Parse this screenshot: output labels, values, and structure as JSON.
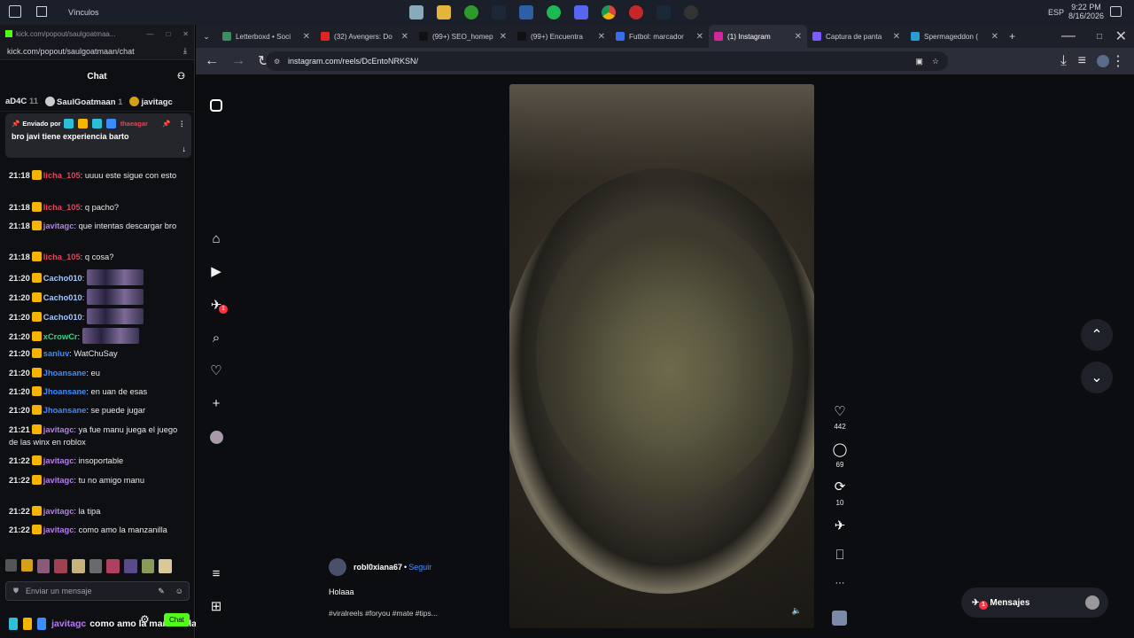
{
  "taskbar": {
    "label": "Vínculos",
    "lang": "ESP",
    "time": "9:22 PM",
    "date": "8/16/2026"
  },
  "kick": {
    "window_title": "kick.com/popout/saulgoatmaa...",
    "url": "kick.com/popout/saulgoatmaan/chat",
    "chat_title": "Chat",
    "leaderboard": [
      {
        "name": "aD4C",
        "count": "11"
      },
      {
        "name": "SaulGoatmaan",
        "count": "1"
      },
      {
        "name": "javitagc",
        "count": ""
      }
    ],
    "pinned": {
      "label": "Enviado por",
      "user": "thaeagar",
      "text": "bro javi tiene experiencia barto"
    },
    "messages": [
      {
        "time": "21:18",
        "user": "licha_105",
        "text": "uuuu este sigue con esto",
        "color": "#e0455a"
      },
      {
        "time": "21:18",
        "user": "licha_105",
        "text": "q pacho?",
        "color": "#e0455a"
      },
      {
        "time": "21:18",
        "user": "javitagc",
        "text": "que intentas descargar bro",
        "color": "#b67cf0"
      },
      {
        "time": "21:18",
        "user": "licha_105",
        "text": "q cosa?",
        "color": "#e0455a"
      },
      {
        "time": "21:20",
        "user": "Cacho010",
        "text": "",
        "color": "#9fc6ff"
      },
      {
        "time": "21:20",
        "user": "Cacho010",
        "text": "",
        "color": "#9fc6ff"
      },
      {
        "time": "21:20",
        "user": "Cacho010",
        "text": "",
        "color": "#9fc6ff"
      },
      {
        "time": "21:20",
        "user": "xCrowCr",
        "text": "",
        "color": "#3ecf8e"
      },
      {
        "time": "21:20",
        "user": "sanluv",
        "text": "WatChuSay",
        "color": "#3a8dff"
      },
      {
        "time": "21:20",
        "user": "Jhoansane",
        "text": "eu",
        "color": "#3a8dff"
      },
      {
        "time": "21:20",
        "user": "Jhoansane",
        "text": "en uan de esas",
        "color": "#3a8dff"
      },
      {
        "time": "21:20",
        "user": "Jhoansane",
        "text": "se puede jugar",
        "color": "#3a8dff"
      },
      {
        "time": "21:21",
        "user": "javitagc",
        "text": "ya fue manu juega el juego de las winx en roblox",
        "color": "#b67cf0"
      },
      {
        "time": "21:22",
        "user": "javitagc",
        "text": "insoportable",
        "color": "#b67cf0"
      },
      {
        "time": "21:22",
        "user": "javitagc",
        "text": "tu no amigo manu",
        "color": "#b67cf0"
      },
      {
        "time": "21:22",
        "user": "javitagc",
        "text": "la tipa",
        "color": "#b67cf0"
      },
      {
        "time": "21:22",
        "user": "javitagc",
        "text": "como amo la manzanilla",
        "color": "#b67cf0"
      }
    ],
    "input_placeholder": "Enviar un mensaje",
    "overlay": {
      "user": "javitagc",
      "text": "como amo la manzanilla",
      "button": "Chat"
    }
  },
  "tabs": [
    {
      "label": "Letterboxd • Soci",
      "color": "#3a8f5f"
    },
    {
      "label": "(32) Avengers: Do",
      "color": "#e02424"
    },
    {
      "label": "(99+) SEO_homep",
      "color": "#111111"
    },
    {
      "label": "(99+) Encuentra",
      "color": "#111111"
    },
    {
      "label": "Futbol: marcador",
      "color": "#3a6ee8"
    },
    {
      "label": "(1) Instagram",
      "color": "#d6249f"
    },
    {
      "label": "Captura de panta",
      "color": "#7c5cff"
    },
    {
      "label": "Spermageddon (",
      "color": "#2b9bd6"
    }
  ],
  "url": "instagram.com/reels/DcEntoNRKSN/",
  "reel": {
    "likes": "442",
    "comments": "69",
    "reposts": "10",
    "user": "robl0xiana67",
    "follow": "Seguir",
    "caption": "Holaaa",
    "tags": "#viralreels #foryou #mate #tips..."
  },
  "nav": {
    "notif_badge": "1"
  },
  "messages_btn": {
    "label": "Mensajes",
    "badge": "1"
  }
}
